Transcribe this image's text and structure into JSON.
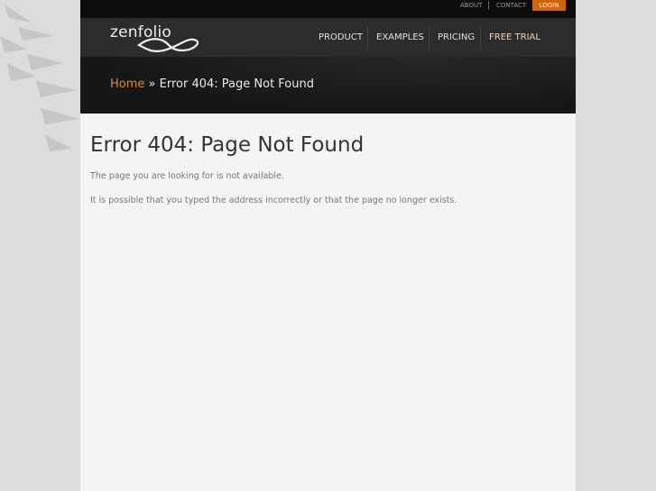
{
  "topbar": {
    "about": "ABOUT",
    "contact": "CONTACT",
    "login": "LOGIN"
  },
  "brand": {
    "name": "zenfolio"
  },
  "nav": {
    "items": [
      "PRODUCT",
      "EXAMPLES",
      "PRICING",
      "FREE TRIAL"
    ]
  },
  "breadcrumb": {
    "home": "Home",
    "separator": "»",
    "current": "Error 404: Page Not Found"
  },
  "main": {
    "title": "Error 404: Page Not Found",
    "para1": "The page you are looking for is not available.",
    "para2": "It is possible that you typed the address incorrectly or that the page no longer exists."
  },
  "colors": {
    "accent": "#d0650d",
    "link": "#e38a2c",
    "free_trial": "#f2d9a4"
  }
}
